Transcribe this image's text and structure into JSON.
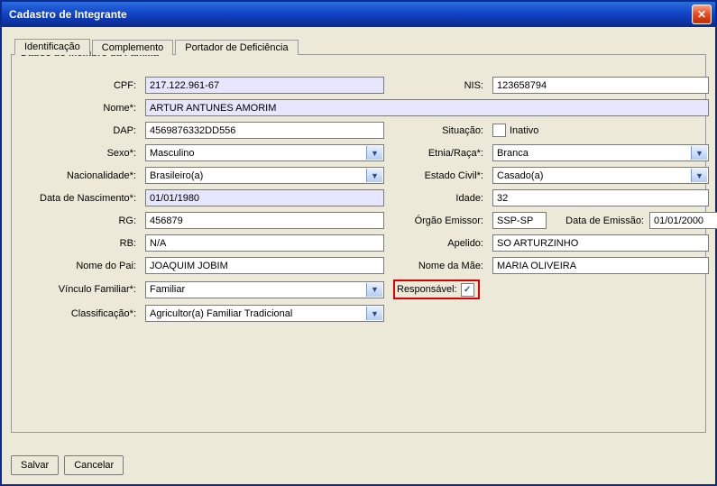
{
  "window": {
    "title": "Cadastro de Integrante"
  },
  "tabs": {
    "identificacao": "Identificação",
    "complemento": "Complemento",
    "portador": "Portador de Deficiência"
  },
  "group": {
    "legend": "Dados do Membro da Família"
  },
  "labels": {
    "cpf": "CPF:",
    "nis": "NIS:",
    "nome": "Nome*:",
    "dap": "DAP:",
    "situacao": "Situação:",
    "sexo": "Sexo*:",
    "etnia": "Etnia/Raça*:",
    "nacionalidade": "Nacionalidade*:",
    "estado_civil": "Estado Civil*:",
    "nascimento": "Data de Nascimento*:",
    "idade": "Idade:",
    "rg": "RG:",
    "orgao": "Órgão Emissor:",
    "emissao": "Data de Emissão:",
    "rb": "RB:",
    "apelido": "Apelido:",
    "pai": "Nome do Pai:",
    "mae": "Nome da Mãe:",
    "vinculo": "Vínculo Familiar*:",
    "responsavel": "Responsável:",
    "classificacao": "Classificação*:",
    "inativo": "Inativo"
  },
  "values": {
    "cpf": "217.122.961-67",
    "nis": "123658794",
    "nome": "ARTUR ANTUNES AMORIM",
    "dap": "4569876332DD556",
    "sexo": "Masculino",
    "etnia": "Branca",
    "nacionalidade": "Brasileiro(a)",
    "estado_civil": "Casado(a)",
    "nascimento": "01/01/1980",
    "idade": "32",
    "rg": "456879",
    "orgao": "SSP-SP",
    "emissao": "01/01/2000",
    "rb": "N/A",
    "apelido": "SO ARTURZINHO",
    "pai": "JOAQUIM JOBIM",
    "mae": "MARIA OLIVEIRA",
    "vinculo": "Familiar",
    "classificacao": "Agricultor(a) Familiar Tradicional"
  },
  "buttons": {
    "salvar": "Salvar",
    "cancelar": "Cancelar"
  },
  "icons": {
    "check": "✓"
  }
}
